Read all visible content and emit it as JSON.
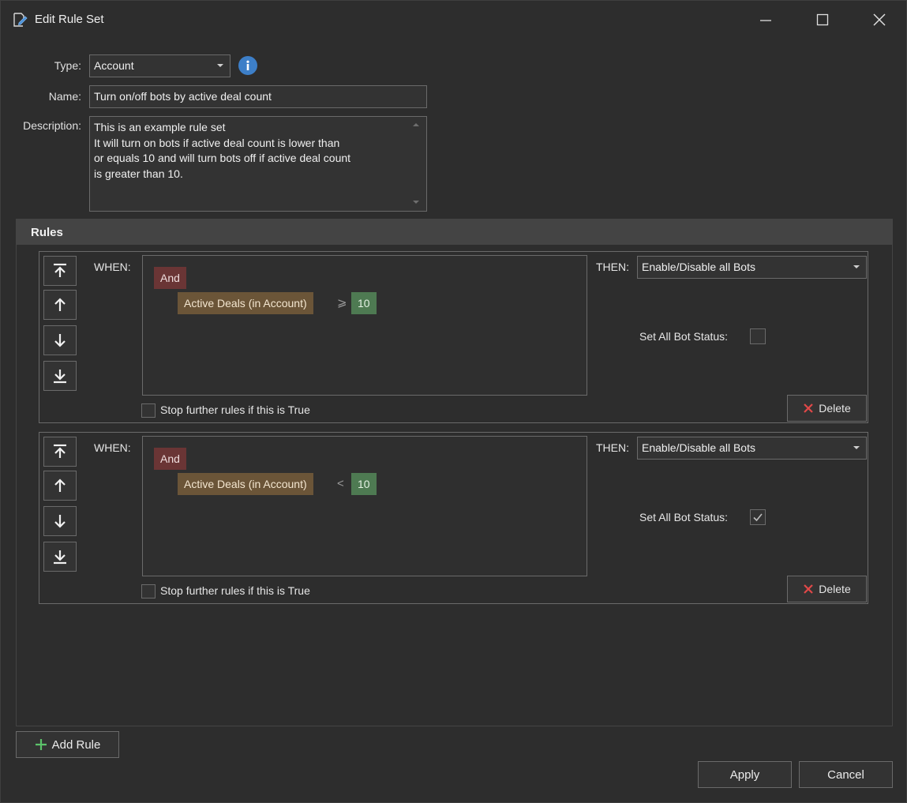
{
  "window": {
    "title": "Edit Rule Set"
  },
  "form": {
    "type_label": "Type:",
    "type_value": "Account",
    "name_label": "Name:",
    "name_value": "Turn on/off bots by active deal count",
    "description_label": "Description:",
    "description_lines": [
      "This is an example rule set",
      "It will turn on bots if active deal count is lower than",
      "or equals 10 and will turn bots off if active deal count",
      "is greater than 10."
    ]
  },
  "rules": {
    "header": "Rules",
    "items": [
      {
        "when_label": "WHEN:",
        "and_label": "And",
        "condition_field": "Active Deals (in Account)",
        "condition_operator": "⩾",
        "condition_value": "10",
        "stop_label": "Stop further rules if this is True",
        "stop_checked": false,
        "then_label": "THEN:",
        "then_action": "Enable/Disable all Bots",
        "status_label": "Set All Bot Status:",
        "status_checked": false,
        "delete_label": "Delete"
      },
      {
        "when_label": "WHEN:",
        "and_label": "And",
        "condition_field": "Active Deals (in Account)",
        "condition_operator": "<",
        "condition_value": "10",
        "stop_label": "Stop further rules if this is True",
        "stop_checked": false,
        "then_label": "THEN:",
        "then_action": "Enable/Disable all Bots",
        "status_label": "Set All Bot Status:",
        "status_checked": true,
        "delete_label": "Delete"
      }
    ]
  },
  "footer": {
    "add_rule_label": "Add Rule",
    "apply_label": "Apply",
    "cancel_label": "Cancel"
  },
  "colors": {
    "background": "#2d2d2d",
    "and_tag": "#6a3535",
    "field_tag": "#6b5538",
    "value_tag": "#4e7a52",
    "info_icon": "#3d7fc8",
    "delete_x": "#e04848",
    "add_plus": "#5cc26a"
  },
  "icons": [
    "edit-rule-set-icon",
    "minimize-icon",
    "maximize-icon",
    "close-icon",
    "info-icon",
    "move-top-icon",
    "move-up-icon",
    "move-down-icon",
    "move-bottom-icon",
    "delete-x-icon",
    "add-plus-icon",
    "checkmark-icon"
  ]
}
